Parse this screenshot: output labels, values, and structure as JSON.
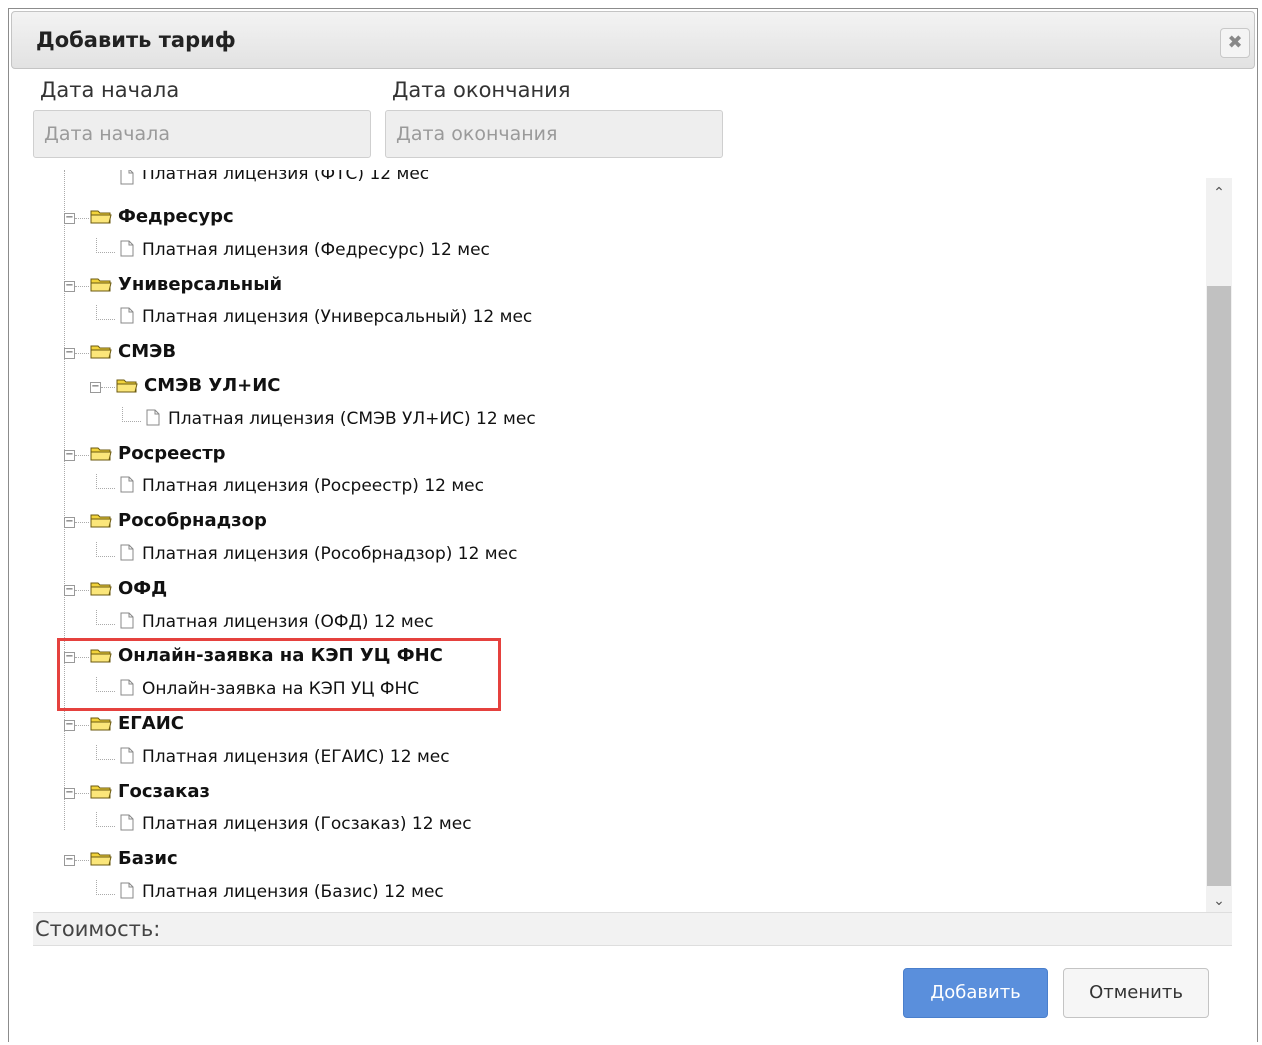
{
  "dialog": {
    "title": "Добавить тариф",
    "close_icon": "close-icon"
  },
  "form": {
    "start_label": "Дата начала",
    "start_placeholder": "Дата начала",
    "end_label": "Дата окончания",
    "end_placeholder": "Дата окончания"
  },
  "tree": {
    "partial_top_item": "Платная лицензия (ФТС) 12 мес",
    "nodes": [
      {
        "folder": "Федресурс",
        "leaf": "Платная лицензия (Федресурс) 12 мес"
      },
      {
        "folder": "Универсальный",
        "leaf": "Платная лицензия (Универсальный) 12 мес"
      },
      {
        "folder": "СМЭВ",
        "child_folder": "СМЭВ УЛ+ИС",
        "leaf": "Платная лицензия (СМЭВ УЛ+ИС) 12 мес"
      },
      {
        "folder": "Росреестр",
        "leaf": "Платная лицензия (Росреестр) 12 мес"
      },
      {
        "folder": "Рособрнадзор",
        "leaf": "Платная лицензия (Рособрнадзор) 12 мес"
      },
      {
        "folder": "ОФД",
        "leaf": "Платная лицензия (ОФД) 12 мес"
      },
      {
        "folder": "Онлайн-заявка на КЭП УЦ ФНС",
        "leaf": "Онлайн-заявка на КЭП УЦ ФНС"
      },
      {
        "folder": "ЕГАИС",
        "leaf": "Платная лицензия (ЕГАИС) 12 мес"
      },
      {
        "folder": "Госзаказ",
        "leaf": "Платная лицензия (Госзаказ) 12 мес"
      },
      {
        "folder": "Базис",
        "leaf": "Платная лицензия (Базис) 12 мес"
      }
    ],
    "highlight_color": "#e5413e"
  },
  "cost": {
    "label": "Стоимость:"
  },
  "buttons": {
    "add": "Добавить",
    "cancel": "Отменить"
  },
  "colors": {
    "primary": "#5a8fdc",
    "folder": "#f2d33b"
  }
}
